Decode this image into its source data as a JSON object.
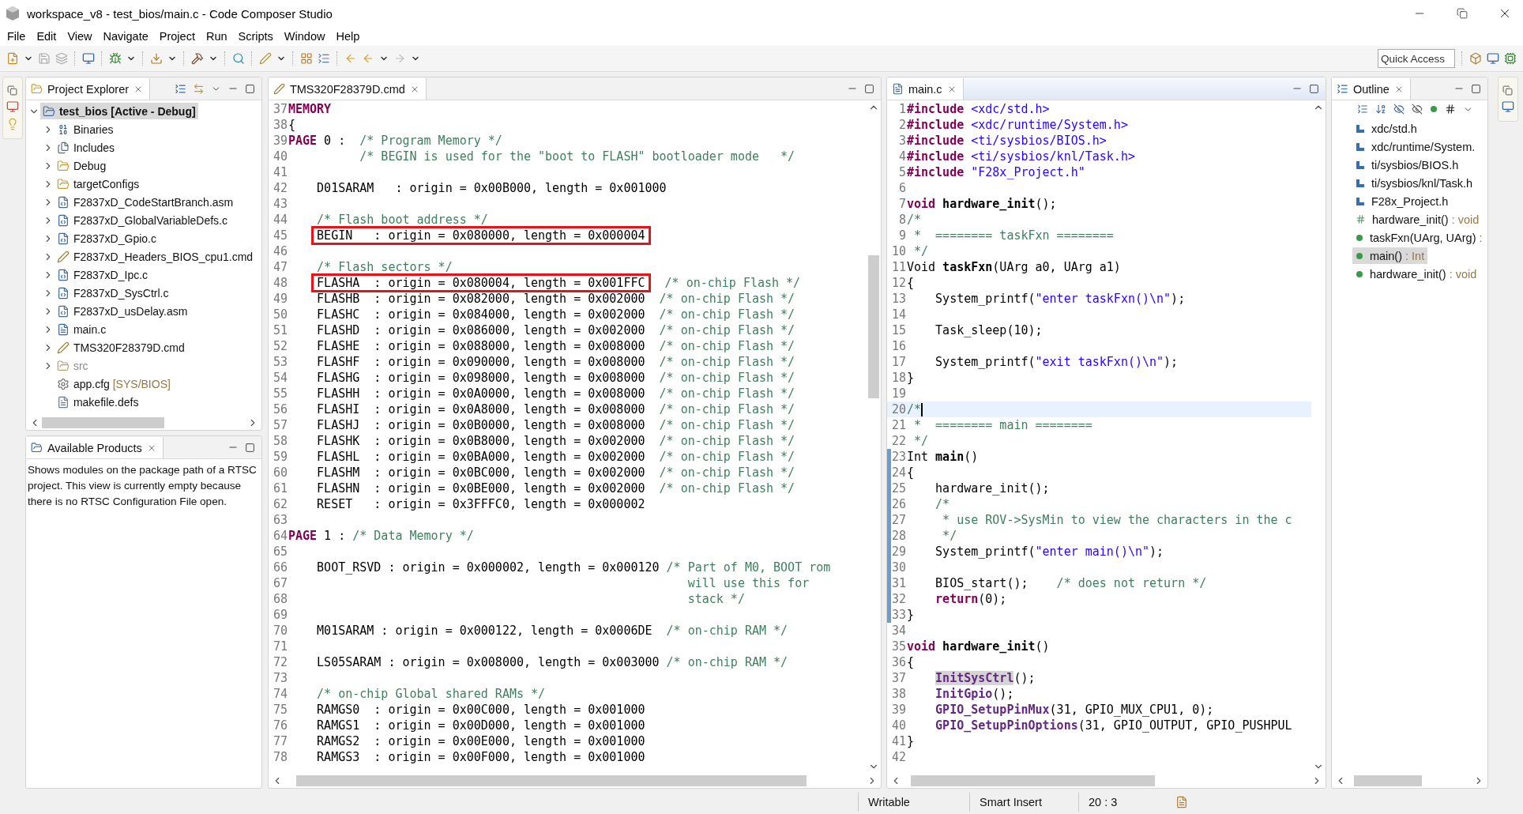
{
  "window": {
    "title": "workspace_v8 - test_bios/main.c - Code Composer Studio"
  },
  "menu": [
    "File",
    "Edit",
    "View",
    "Navigate",
    "Project",
    "Run",
    "Scripts",
    "Window",
    "Help"
  ],
  "quick_access": {
    "placeholder": "Quick Access"
  },
  "explorer": {
    "title": "Project Explorer",
    "tree": [
      {
        "label": "test_bios  [Active - Debug]",
        "kind": "project",
        "expanded": true,
        "selected": true,
        "children": [
          {
            "label": "Binaries",
            "kind": "binaries",
            "expanded": false,
            "selected": false
          },
          {
            "label": "Includes",
            "kind": "includes",
            "expanded": false,
            "selected": false
          },
          {
            "label": "Debug",
            "kind": "folder",
            "expanded": false,
            "selected": false
          },
          {
            "label": "targetConfigs",
            "kind": "folder",
            "expanded": false,
            "selected": false
          },
          {
            "label": "F2837xD_CodeStartBranch.asm",
            "kind": "asm",
            "expanded": false,
            "selected": false
          },
          {
            "label": "F2837xD_GlobalVariableDefs.c",
            "kind": "source",
            "expanded": false,
            "selected": false
          },
          {
            "label": "F2837xD_Gpio.c",
            "kind": "source",
            "expanded": false,
            "selected": false
          },
          {
            "label": "F2837xD_Headers_BIOS_cpu1.cmd",
            "kind": "cmd",
            "expanded": false,
            "selected": false
          },
          {
            "label": "F2837xD_Ipc.c",
            "kind": "source",
            "expanded": false,
            "selected": false
          },
          {
            "label": "F2837xD_SysCtrl.c",
            "kind": "source",
            "expanded": false,
            "selected": false
          },
          {
            "label": "F2837xD_usDelay.asm",
            "kind": "asm",
            "expanded": false,
            "selected": false
          },
          {
            "label": "main.c",
            "kind": "c",
            "expanded": false,
            "selected": false
          },
          {
            "label": "TMS320F28379D.cmd",
            "kind": "cmd",
            "expanded": false,
            "selected": false
          },
          {
            "label": "src",
            "kind": "excluded",
            "expanded": false,
            "selected": false
          },
          {
            "label": "app.cfg",
            "decoration": "[SYS/BIOS]",
            "kind": "config",
            "selected": false
          },
          {
            "label": "makefile.defs",
            "kind": "makefile",
            "selected": false
          }
        ]
      }
    ]
  },
  "products": {
    "title": "Available Products",
    "text": "Shows modules on the package path of a RTSC project. This view is currently empty because there is no RTSC Configuration File open."
  },
  "editors": [
    {
      "tab": "TMS320F28379D.cmd",
      "kind": "cmd",
      "active": false,
      "lines": [
        {
          "n": "37",
          "tokens": [
            {
              "kind": "keyword",
              "text": "MEMORY"
            }
          ]
        },
        {
          "n": "38",
          "tokens": [
            {
              "kind": "plain",
              "text": "{"
            }
          ]
        },
        {
          "n": "39",
          "tokens": [
            {
              "kind": "keyword",
              "text": "PAGE"
            },
            {
              "kind": "plain",
              "text": " 0 :  "
            },
            {
              "kind": "comment",
              "text": "/* Program Memory */"
            }
          ]
        },
        {
          "n": "40",
          "tokens": [
            {
              "kind": "comment",
              "text": "          /* BEGIN is used for the \"boot to FLASH\" bootloader mode   */"
            }
          ]
        },
        {
          "n": "41"
        },
        {
          "n": "42",
          "tokens": [
            {
              "kind": "plain",
              "text": "    D01SARAM   : origin = 0x00B000, length = 0x001000"
            }
          ]
        },
        {
          "n": "43"
        },
        {
          "n": "44",
          "tokens": [
            {
              "kind": "comment",
              "text": "    /* Flash boot address */"
            }
          ]
        },
        {
          "n": "45",
          "tokens": [
            {
              "kind": "boxed",
              "text": "    BEGIN   : origin = 0x080000, length = 0x000004"
            }
          ]
        },
        {
          "n": "46"
        },
        {
          "n": "47",
          "tokens": [
            {
              "kind": "comment",
              "text": "    /* Flash sectors */"
            }
          ]
        },
        {
          "n": "48",
          "tokens": [
            {
              "kind": "boxed",
              "text": "    FLASHA  : origin = 0x080004, length = 0x001FFC"
            },
            {
              "kind": "comment",
              "text": "  /* on-chip Flash */"
            }
          ]
        },
        {
          "n": "49",
          "tokens": [
            {
              "kind": "plain",
              "text": "    FLASHB  : origin = 0x082000, length = 0x002000  "
            },
            {
              "kind": "comment",
              "text": "/* on-chip Flash */"
            }
          ]
        },
        {
          "n": "50",
          "tokens": [
            {
              "kind": "plain",
              "text": "    FLASHC  : origin = 0x084000, length = 0x002000  "
            },
            {
              "kind": "comment",
              "text": "/* on-chip Flash */"
            }
          ]
        },
        {
          "n": "51",
          "tokens": [
            {
              "kind": "plain",
              "text": "    FLASHD  : origin = 0x086000, length = 0x002000  "
            },
            {
              "kind": "comment",
              "text": "/* on-chip Flash */"
            }
          ]
        },
        {
          "n": "52",
          "tokens": [
            {
              "kind": "plain",
              "text": "    FLASHE  : origin = 0x088000, length = 0x008000  "
            },
            {
              "kind": "comment",
              "text": "/* on-chip Flash */"
            }
          ]
        },
        {
          "n": "53",
          "tokens": [
            {
              "kind": "plain",
              "text": "    FLASHF  : origin = 0x090000, length = 0x008000  "
            },
            {
              "kind": "comment",
              "text": "/* on-chip Flash */"
            }
          ]
        },
        {
          "n": "54",
          "tokens": [
            {
              "kind": "plain",
              "text": "    FLASHG  : origin = 0x098000, length = 0x008000  "
            },
            {
              "kind": "comment",
              "text": "/* on-chip Flash */"
            }
          ]
        },
        {
          "n": "55",
          "tokens": [
            {
              "kind": "plain",
              "text": "    FLASHH  : origin = 0x0A0000, length = 0x008000  "
            },
            {
              "kind": "comment",
              "text": "/* on-chip Flash */"
            }
          ]
        },
        {
          "n": "56",
          "tokens": [
            {
              "kind": "plain",
              "text": "    FLASHI  : origin = 0x0A8000, length = 0x008000  "
            },
            {
              "kind": "comment",
              "text": "/* on-chip Flash */"
            }
          ]
        },
        {
          "n": "57",
          "tokens": [
            {
              "kind": "plain",
              "text": "    FLASHJ  : origin = 0x0B0000, length = 0x008000  "
            },
            {
              "kind": "comment",
              "text": "/* on-chip Flash */"
            }
          ]
        },
        {
          "n": "58",
          "tokens": [
            {
              "kind": "plain",
              "text": "    FLASHK  : origin = 0x0B8000, length = 0x002000  "
            },
            {
              "kind": "comment",
              "text": "/* on-chip Flash */"
            }
          ]
        },
        {
          "n": "59",
          "tokens": [
            {
              "kind": "plain",
              "text": "    FLASHL  : origin = 0x0BA000, length = 0x002000  "
            },
            {
              "kind": "comment",
              "text": "/* on-chip Flash */"
            }
          ]
        },
        {
          "n": "60",
          "tokens": [
            {
              "kind": "plain",
              "text": "    FLASHM  : origin = 0x0BC000, length = 0x002000  "
            },
            {
              "kind": "comment",
              "text": "/* on-chip Flash */"
            }
          ]
        },
        {
          "n": "61",
          "tokens": [
            {
              "kind": "plain",
              "text": "    FLASHN  : origin = 0x0BE000, length = 0x002000  "
            },
            {
              "kind": "comment",
              "text": "/* on-chip Flash */"
            }
          ]
        },
        {
          "n": "62",
          "tokens": [
            {
              "kind": "plain",
              "text": "    RESET   : origin = 0x3FFFC0, length = 0x000002"
            }
          ]
        },
        {
          "n": "63"
        },
        {
          "n": "64",
          "tokens": [
            {
              "kind": "keyword",
              "text": "PAGE"
            },
            {
              "kind": "plain",
              "text": " 1 : "
            },
            {
              "kind": "comment",
              "text": "/* Data Memory */"
            }
          ]
        },
        {
          "n": "65"
        },
        {
          "n": "66",
          "tokens": [
            {
              "kind": "plain",
              "text": "    BOOT_RSVD : origin = 0x000002, length = 0x000120 "
            },
            {
              "kind": "comment",
              "text": "/* Part of M0, BOOT rom"
            }
          ]
        },
        {
          "n": "67",
          "tokens": [
            {
              "kind": "comment",
              "text": "                                                        will use this for"
            }
          ]
        },
        {
          "n": "68",
          "tokens": [
            {
              "kind": "comment",
              "text": "                                                        stack */"
            }
          ]
        },
        {
          "n": "69"
        },
        {
          "n": "70",
          "tokens": [
            {
              "kind": "plain",
              "text": "    M01SARAM : origin = 0x000122, length = 0x0006DE  "
            },
            {
              "kind": "comment",
              "text": "/* on-chip RAM */"
            }
          ]
        },
        {
          "n": "71"
        },
        {
          "n": "72",
          "tokens": [
            {
              "kind": "plain",
              "text": "    LS05SARAM : origin = 0x008000, length = 0x003000 "
            },
            {
              "kind": "comment",
              "text": "/* on-chip RAM */"
            }
          ]
        },
        {
          "n": "73"
        },
        {
          "n": "74",
          "tokens": [
            {
              "kind": "comment",
              "text": "    /* on-chip Global shared RAMs */"
            }
          ]
        },
        {
          "n": "75",
          "tokens": [
            {
              "kind": "plain",
              "text": "    RAMGS0  : origin = 0x00C000, length = 0x001000"
            }
          ]
        },
        {
          "n": "76",
          "tokens": [
            {
              "kind": "plain",
              "text": "    RAMGS1  : origin = 0x00D000, length = 0x001000"
            }
          ]
        },
        {
          "n": "77",
          "tokens": [
            {
              "kind": "plain",
              "text": "    RAMGS2  : origin = 0x00E000, length = 0x001000"
            }
          ]
        },
        {
          "n": "78",
          "tokens": [
            {
              "kind": "plain",
              "text": "    RAMGS3  : origin = 0x00F000, length = 0x001000"
            }
          ]
        }
      ]
    },
    {
      "tab": "main.c",
      "kind": "c",
      "active": true,
      "lines": [
        {
          "n": "1",
          "tokens": [
            {
              "kind": "keyword",
              "text": "#include"
            },
            {
              "kind": "string",
              "text": " <xdc/std.h>"
            }
          ]
        },
        {
          "n": "2",
          "tokens": [
            {
              "kind": "keyword",
              "text": "#include"
            },
            {
              "kind": "string",
              "text": " <xdc/runtime/System.h>"
            }
          ]
        },
        {
          "n": "3",
          "tokens": [
            {
              "kind": "keyword",
              "text": "#include"
            },
            {
              "kind": "string",
              "text": " <ti/sysbios/BIOS.h>"
            }
          ]
        },
        {
          "n": "4",
          "tokens": [
            {
              "kind": "keyword",
              "text": "#include"
            },
            {
              "kind": "string",
              "text": " <ti/sysbios/knl/Task.h>"
            }
          ]
        },
        {
          "n": "5",
          "tokens": [
            {
              "kind": "keyword",
              "text": "#include"
            },
            {
              "kind": "string",
              "text": " \"F28x_Project.h\""
            }
          ]
        },
        {
          "n": "6"
        },
        {
          "n": "7",
          "tokens": [
            {
              "kind": "keyword",
              "text": "void"
            },
            {
              "kind": "name",
              "text": " hardware_init"
            },
            {
              "kind": "plain",
              "text": "();"
            }
          ]
        },
        {
          "n": "8",
          "tokens": [
            {
              "kind": "comment",
              "text": "/*"
            }
          ]
        },
        {
          "n": "9",
          "tokens": [
            {
              "kind": "comment",
              "text": " *  ======== taskFxn ========"
            }
          ]
        },
        {
          "n": "10",
          "tokens": [
            {
              "kind": "comment",
              "text": " */"
            }
          ]
        },
        {
          "n": "11",
          "tokens": [
            {
              "kind": "plain",
              "text": "Void "
            },
            {
              "kind": "name",
              "text": "taskFxn"
            },
            {
              "kind": "plain",
              "text": "(UArg a0, UArg a1)"
            }
          ]
        },
        {
          "n": "12",
          "tokens": [
            {
              "kind": "plain",
              "text": "{"
            }
          ]
        },
        {
          "n": "13",
          "tokens": [
            {
              "kind": "plain",
              "text": "    System_printf("
            },
            {
              "kind": "string",
              "text": "\"enter taskFxn()\\n\""
            },
            {
              "kind": "plain",
              "text": ");"
            }
          ]
        },
        {
          "n": "14"
        },
        {
          "n": "15",
          "tokens": [
            {
              "kind": "plain",
              "text": "    Task_sleep(10);"
            }
          ]
        },
        {
          "n": "16"
        },
        {
          "n": "17",
          "tokens": [
            {
              "kind": "plain",
              "text": "    System_printf("
            },
            {
              "kind": "string",
              "text": "\"exit taskFxn()\\n\""
            },
            {
              "kind": "plain",
              "text": ");"
            }
          ]
        },
        {
          "n": "18",
          "tokens": [
            {
              "kind": "plain",
              "text": "}"
            }
          ]
        },
        {
          "n": "19"
        },
        {
          "n": "20",
          "current": true,
          "tokens": [
            {
              "kind": "comment",
              "text": "/*"
            }
          ]
        },
        {
          "n": "21",
          "tokens": [
            {
              "kind": "comment",
              "text": " *  ======== main ========"
            }
          ]
        },
        {
          "n": "22",
          "tokens": [
            {
              "kind": "comment",
              "text": " */"
            }
          ]
        },
        {
          "n": "23",
          "changed": true,
          "tokens": [
            {
              "kind": "plain",
              "text": "Int "
            },
            {
              "kind": "name",
              "text": "main"
            },
            {
              "kind": "plain",
              "text": "()"
            }
          ]
        },
        {
          "n": "24",
          "changed": true,
          "tokens": [
            {
              "kind": "plain",
              "text": "{"
            }
          ]
        },
        {
          "n": "25",
          "changed": true,
          "tokens": [
            {
              "kind": "plain",
              "text": "    hardware_init();"
            }
          ]
        },
        {
          "n": "26",
          "changed": true,
          "tokens": [
            {
              "kind": "comment",
              "text": "    /*"
            }
          ]
        },
        {
          "n": "27",
          "changed": true,
          "tokens": [
            {
              "kind": "comment",
              "text": "     * use ROV->SysMin to view the characters in the c"
            }
          ]
        },
        {
          "n": "28",
          "changed": true,
          "tokens": [
            {
              "kind": "comment",
              "text": "     */"
            }
          ]
        },
        {
          "n": "29",
          "changed": true,
          "tokens": [
            {
              "kind": "plain",
              "text": "    System_printf("
            },
            {
              "kind": "string",
              "text": "\"enter main()\\n\""
            },
            {
              "kind": "plain",
              "text": ");"
            }
          ]
        },
        {
          "n": "30",
          "changed": true
        },
        {
          "n": "31",
          "changed": true,
          "tokens": [
            {
              "kind": "plain",
              "text": "    BIOS_start();    "
            },
            {
              "kind": "comment",
              "text": "/* does not return */"
            }
          ]
        },
        {
          "n": "32",
          "changed": true,
          "tokens": [
            {
              "kind": "keyword",
              "text": "    return"
            },
            {
              "kind": "plain",
              "text": "(0);"
            }
          ]
        },
        {
          "n": "33",
          "changed": true,
          "tokens": [
            {
              "kind": "plain",
              "text": "}"
            }
          ]
        },
        {
          "n": "34"
        },
        {
          "n": "35",
          "tokens": [
            {
              "kind": "keyword",
              "text": "void"
            },
            {
              "kind": "name",
              "text": " hardware_init"
            },
            {
              "kind": "plain",
              "text": "()"
            }
          ]
        },
        {
          "n": "36",
          "tokens": [
            {
              "kind": "plain",
              "text": "{"
            }
          ]
        },
        {
          "n": "37",
          "tokens": [
            {
              "kind": "occurrence",
              "text": "    InitSysCtrl"
            },
            {
              "kind": "plain",
              "text": "();"
            }
          ]
        },
        {
          "n": "38",
          "tokens": [
            {
              "kind": "call",
              "text": "    InitGpio"
            },
            {
              "kind": "plain",
              "text": "();"
            }
          ]
        },
        {
          "n": "39",
          "tokens": [
            {
              "kind": "call",
              "text": "    GPIO_SetupPinMux"
            },
            {
              "kind": "plain",
              "text": "(31, GPIO_MUX_CPU1, 0);"
            }
          ]
        },
        {
          "n": "40",
          "tokens": [
            {
              "kind": "call",
              "text": "    GPIO_SetupPinOptions"
            },
            {
              "kind": "plain",
              "text": "(31, GPIO_OUTPUT, GPIO_PUSHPUL"
            }
          ]
        },
        {
          "n": "41",
          "tokens": [
            {
              "kind": "plain",
              "text": "}"
            }
          ]
        },
        {
          "n": "42"
        }
      ]
    }
  ],
  "outline": {
    "title": "Outline",
    "items": [
      {
        "label": "xdc/std.h",
        "kind": "include",
        "selected": false
      },
      {
        "label": "xdc/runtime/System.",
        "kind": "include",
        "selected": false
      },
      {
        "label": "ti/sysbios/BIOS.h",
        "kind": "include",
        "selected": false
      },
      {
        "label": "ti/sysbios/knl/Task.h",
        "kind": "include",
        "selected": false
      },
      {
        "label": "F28x_Project.h",
        "kind": "include",
        "selected": false
      },
      {
        "label": "hardware_init()",
        "type": " : void",
        "kind": "declaration",
        "selected": false
      },
      {
        "label": "taskFxn(UArg, UArg)",
        "type": " :",
        "kind": "function",
        "selected": false
      },
      {
        "label": "main()",
        "type": " : Int",
        "kind": "function",
        "selected": true
      },
      {
        "label": "hardware_init()",
        "type": " : void",
        "kind": "function",
        "selected": false
      }
    ]
  },
  "status_bar": [
    "Writable",
    "Smart Insert",
    "20 : 3"
  ]
}
